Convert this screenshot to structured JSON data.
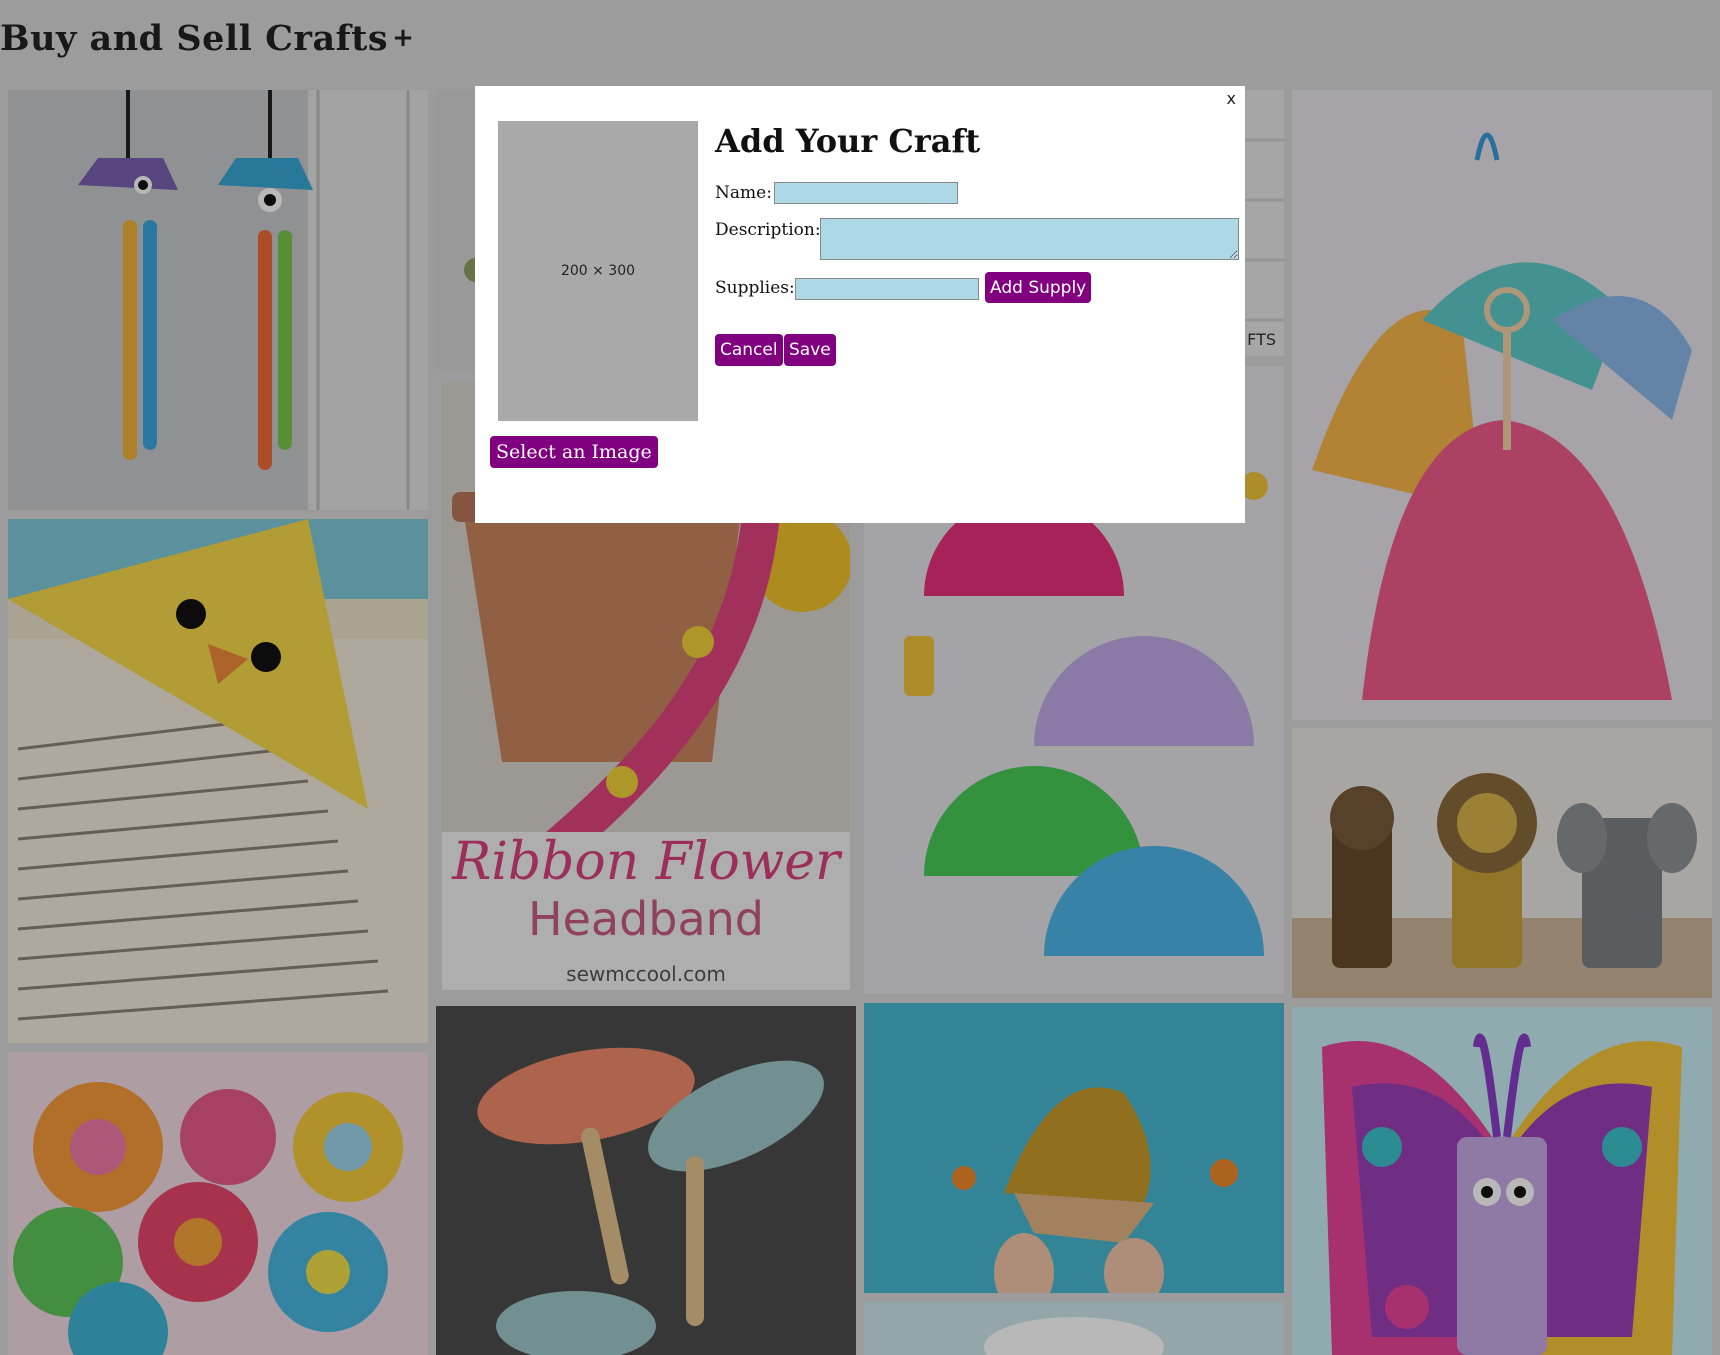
{
  "header": {
    "title": "Buy and Sell Crafts",
    "add_icon": "+"
  },
  "gallery": {
    "tiles": [
      {
        "name": "jellyfish-beads",
        "color": "#c7c9cc",
        "accent": "#7a4fa0"
      },
      {
        "name": "chick-bookmark",
        "color": "#ece2c9",
        "accent": "#f3d84a"
      },
      {
        "name": "felt-flowers",
        "color": "#f2dbe3",
        "accent": "#e94e9a"
      },
      {
        "name": "crafts-top-middle",
        "color": "#cfcfcf",
        "accent": "#8ca060"
      },
      {
        "name": "ribbon-flower-headband",
        "color": "#d8d2cc",
        "accent": "#e0457d",
        "caption1": "Ribbon Flower",
        "caption2": "Headband",
        "caption3": "sewmccool.com"
      },
      {
        "name": "handprint-fish",
        "color": "#4d4d4d",
        "accent": "#f08a6a"
      },
      {
        "name": "crafts-banner",
        "color": "#e6e6e6",
        "accent": "#444",
        "caption1": "FTS"
      },
      {
        "name": "paper-plate-dinosaurs",
        "color": "#e4e4e8",
        "accent": "#3fc64a"
      },
      {
        "name": "leaf-hedgehog",
        "color": "#49b8d1",
        "accent": "#c89a2a"
      },
      {
        "name": "clouds",
        "color": "#cfe6ee",
        "accent": "#ffffff"
      },
      {
        "name": "coffee-filter-dancers",
        "color": "#e8e4ea",
        "accent": "#f06a9a"
      },
      {
        "name": "toilet-roll-animals",
        "color": "#e8e6e2",
        "accent": "#8a6a3a"
      },
      {
        "name": "toilet-roll-butterfly",
        "color": "#c6eef3",
        "accent": "#9a3fb8"
      }
    ]
  },
  "modal": {
    "close_label": "x",
    "placeholder_label": "200 × 300",
    "select_image_label": "Select an Image",
    "title": "Add Your Craft",
    "name_label": "Name:",
    "name_value": "",
    "description_label": "Description:",
    "description_value": "",
    "supplies_label": "Supplies:",
    "supplies_value": "",
    "add_supply_label": "Add Supply",
    "cancel_label": "Cancel",
    "save_label": "Save"
  }
}
